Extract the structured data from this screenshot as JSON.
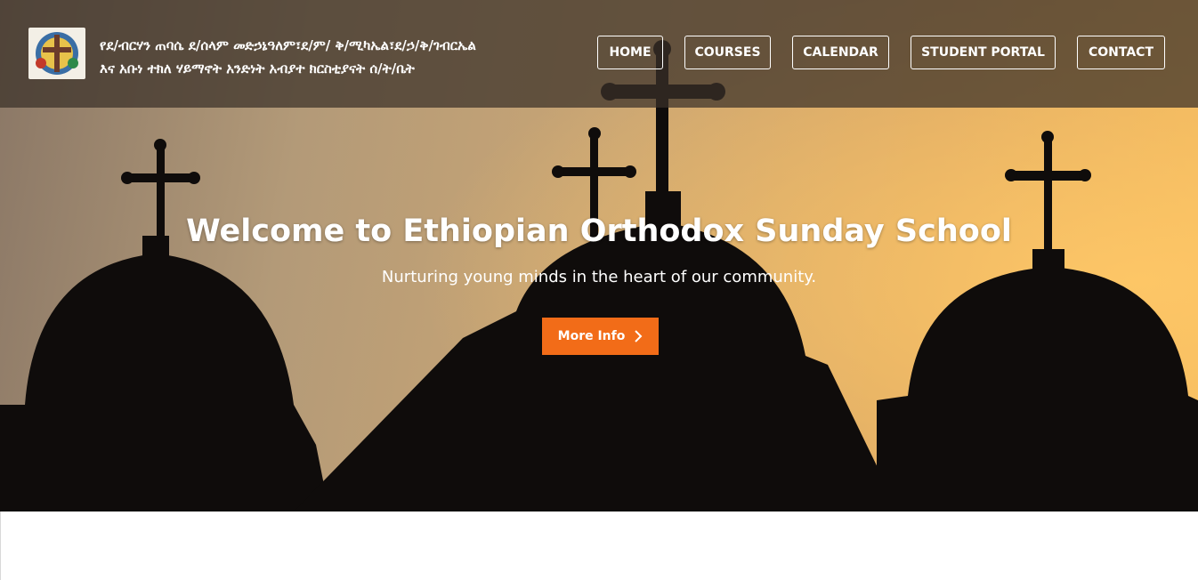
{
  "header": {
    "logo_icon": "church-emblem-icon",
    "site_name_line1": "የደ/ብርሃን ጠባሴ ደ/ሰላም መድኃኔዓለም፣ደ/ም/ ቅ/ሚካኤል፣ደ/ኃ/ቅ/ገብርኤል",
    "site_name_line2": "እና አቡነ ተክለ ሃይማኖት አንድነት አብያተ ክርስቲያናት ሰ/ት/ቤት"
  },
  "nav": {
    "items": [
      "HOME",
      "COURSES",
      "CALENDAR",
      "STUDENT PORTAL",
      "CONTACT"
    ]
  },
  "hero": {
    "title": "Welcome to Ethiopian Orthodox Sunday School",
    "subtitle": "Nurturing young minds in the heart of our community.",
    "cta_label": "More Info",
    "cta_icon": "chevron-right-icon",
    "background_image": "church-domes-crosses-silhouette",
    "accent_color": "#f26c18"
  }
}
